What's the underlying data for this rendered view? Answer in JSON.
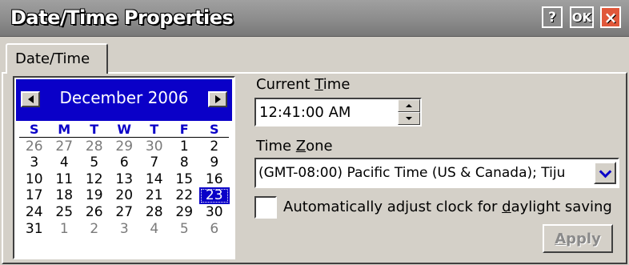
{
  "window": {
    "title": "Date/Time Properties",
    "help_label": "?",
    "ok_label": "OK",
    "close_label": "×"
  },
  "tabs": [
    {
      "label": "Date/Time",
      "active": true
    }
  ],
  "calendar": {
    "month_label": "December 2006",
    "weekdays": [
      "S",
      "M",
      "T",
      "W",
      "T",
      "F",
      "S"
    ],
    "weeks": [
      [
        [
          "26",
          true
        ],
        [
          "27",
          true
        ],
        [
          "28",
          true
        ],
        [
          "29",
          true
        ],
        [
          "30",
          true
        ],
        [
          "1",
          false
        ],
        [
          "2",
          false
        ]
      ],
      [
        [
          "3",
          false
        ],
        [
          "4",
          false
        ],
        [
          "5",
          false
        ],
        [
          "6",
          false
        ],
        [
          "7",
          false
        ],
        [
          "8",
          false
        ],
        [
          "9",
          false
        ]
      ],
      [
        [
          "10",
          false
        ],
        [
          "11",
          false
        ],
        [
          "12",
          false
        ],
        [
          "13",
          false
        ],
        [
          "14",
          false
        ],
        [
          "15",
          false
        ],
        [
          "16",
          false
        ]
      ],
      [
        [
          "17",
          false
        ],
        [
          "18",
          false
        ],
        [
          "19",
          false
        ],
        [
          "20",
          false
        ],
        [
          "21",
          false
        ],
        [
          "22",
          false
        ],
        [
          "23",
          false
        ]
      ],
      [
        [
          "24",
          false
        ],
        [
          "25",
          false
        ],
        [
          "26",
          false
        ],
        [
          "27",
          false
        ],
        [
          "28",
          false
        ],
        [
          "29",
          false
        ],
        [
          "30",
          false
        ]
      ],
      [
        [
          "31",
          false
        ],
        [
          "1",
          true
        ],
        [
          "2",
          true
        ],
        [
          "3",
          true
        ],
        [
          "4",
          true
        ],
        [
          "5",
          true
        ],
        [
          "6",
          true
        ]
      ]
    ],
    "selected_day": "23",
    "accent_color": "#0a00c8",
    "other_month_color": "#7a7a7a"
  },
  "current_time": {
    "label_pre": "Current ",
    "label_key": "T",
    "label_post": "ime",
    "value": "12:41:00 AM"
  },
  "time_zone": {
    "label_pre": "Time ",
    "label_key": "Z",
    "label_post": "one",
    "value": "(GMT-08:00) Pacific Time (US & Canada); Tiju"
  },
  "daylight": {
    "label_pre": "Automatically adjust clock for ",
    "label_key": "d",
    "label_post": "aylight saving",
    "checked": false
  },
  "apply_button": {
    "label_key": "A",
    "label_post": "pply",
    "enabled": false
  },
  "colors": {
    "dialog_bg": "#d4d0c8",
    "close_button": "#e0573a"
  }
}
